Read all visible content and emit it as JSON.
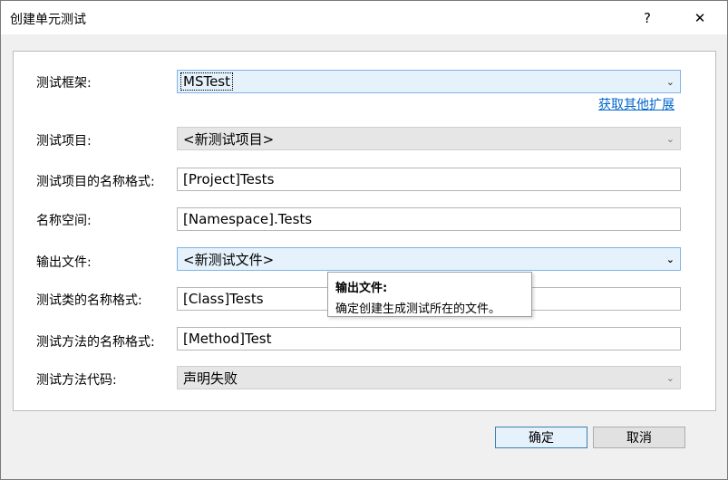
{
  "window": {
    "title": "创建单元测试",
    "help_label": "?",
    "close_label": "✕"
  },
  "form": {
    "framework": {
      "label": "测试框架:",
      "value": "MSTest"
    },
    "more_link": "获取其他扩展",
    "test_project": {
      "label": "测试项目:",
      "value": "<新测试项目>"
    },
    "project_name_format": {
      "label": "测试项目的名称格式:",
      "value": "[Project]Tests"
    },
    "namespace": {
      "label": "名称空间:",
      "value": "[Namespace].Tests"
    },
    "output_file": {
      "label": "输出文件:",
      "value": "<新测试文件>"
    },
    "class_name_format": {
      "label": "测试类的名称格式:",
      "value": "[Class]Tests"
    },
    "method_name_format": {
      "label": "测试方法的名称格式:",
      "value": "[Method]Test"
    },
    "method_code": {
      "label": "测试方法代码:",
      "value": "声明失败"
    }
  },
  "tooltip": {
    "title": "输出文件:",
    "text": "确定创建生成测试所在的文件。"
  },
  "buttons": {
    "ok": "确定",
    "cancel": "取消"
  },
  "icons": {
    "dropdown": "chevron-down-icon"
  }
}
